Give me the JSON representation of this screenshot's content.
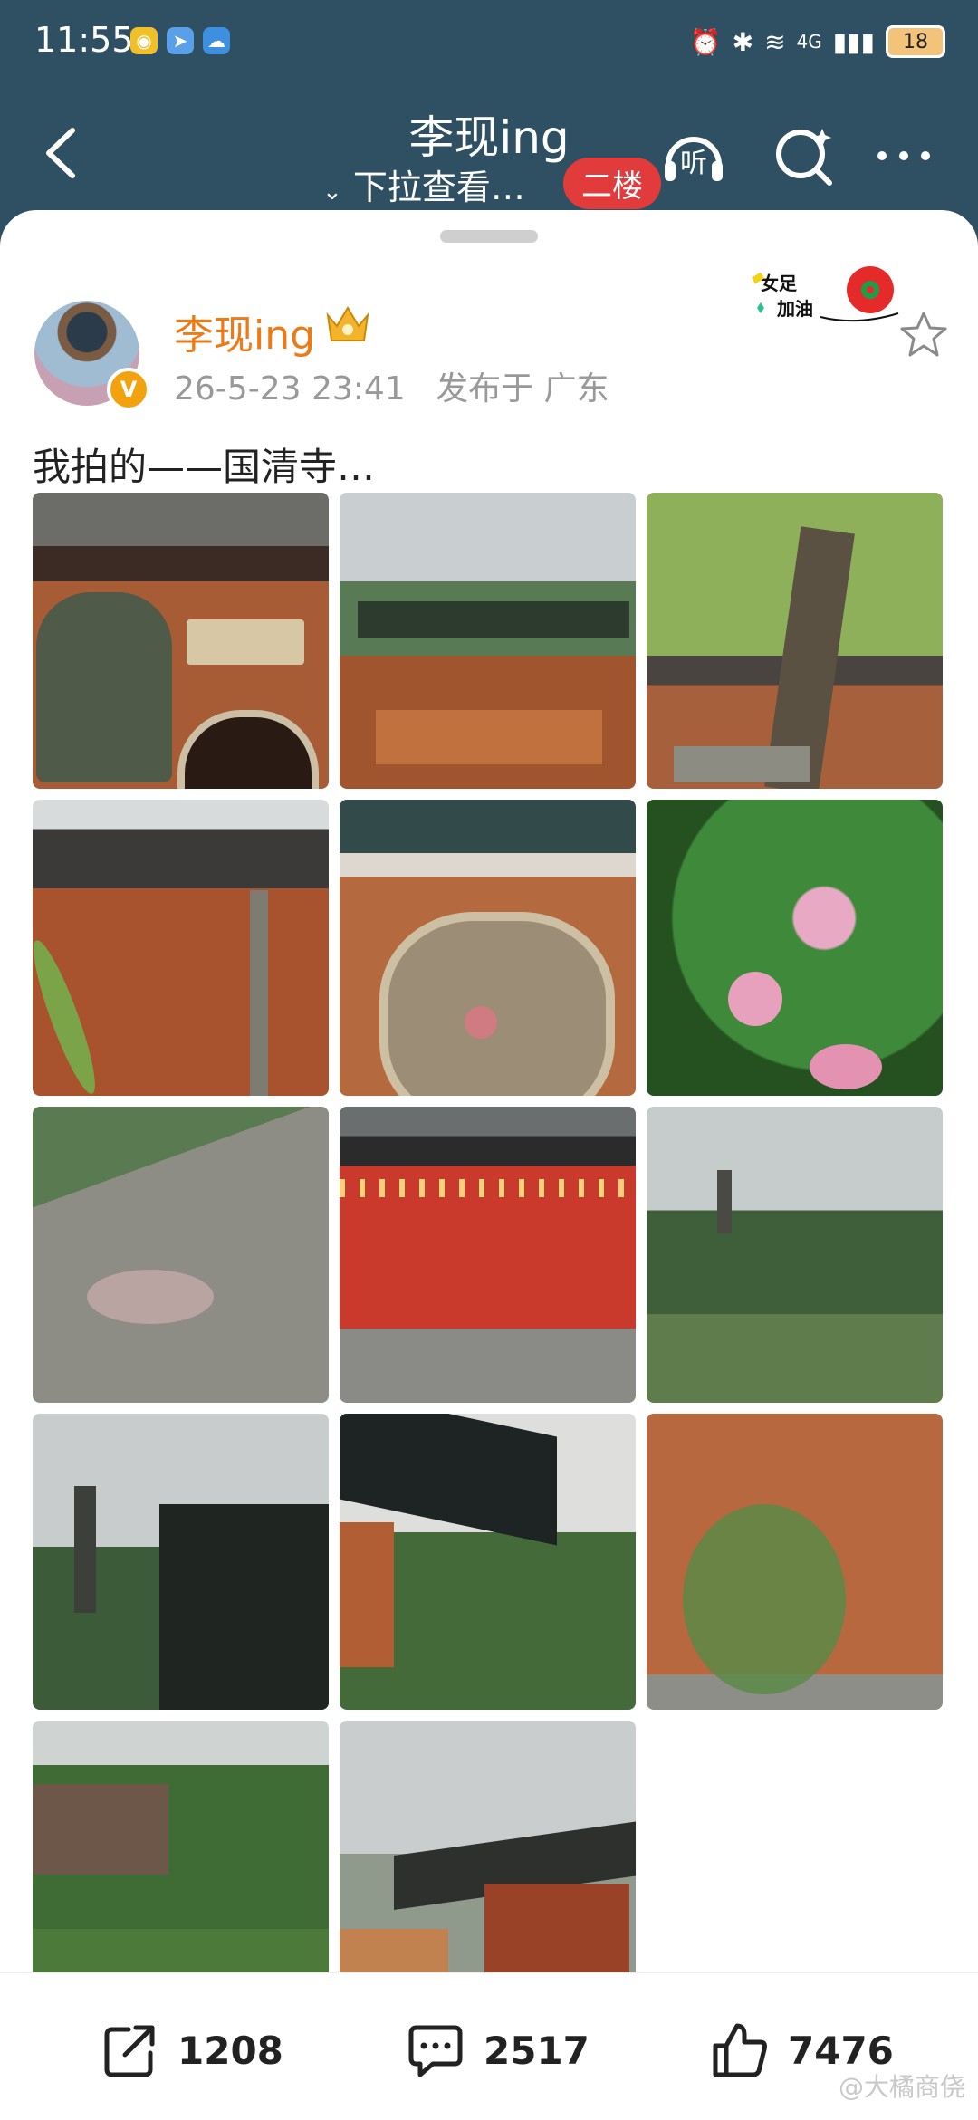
{
  "status_bar": {
    "time": "11:55",
    "network": "4G",
    "battery": "18"
  },
  "header": {
    "title": "李现ing",
    "subtitle": "下拉查看…",
    "floor_badge": "二楼",
    "listen_label": "听"
  },
  "post": {
    "author": "李现ing",
    "verified_badge": "V",
    "time": "26-5-23 23:41",
    "location": "发布于 广东",
    "sticker_line1": "女足",
    "sticker_line2": "加油",
    "text": "我拍的——国清寺…",
    "photos": [
      {
        "name": "photo-lion-gate"
      },
      {
        "name": "photo-misty-gate"
      },
      {
        "name": "photo-tree-wall"
      },
      {
        "name": "photo-courtyard"
      },
      {
        "name": "photo-window"
      },
      {
        "name": "photo-blossom"
      },
      {
        "name": "photo-petals"
      },
      {
        "name": "photo-candles"
      },
      {
        "name": "photo-pagoda-field"
      },
      {
        "name": "photo-pagoda-roof"
      },
      {
        "name": "photo-eaves"
      },
      {
        "name": "photo-red-wall"
      },
      {
        "name": "photo-garden"
      },
      {
        "name": "photo-hall"
      }
    ]
  },
  "actions": {
    "repost_count": "1208",
    "comment_count": "2517",
    "like_count": "7476"
  },
  "watermark": "@大橘商侥",
  "colors": {
    "header_bg": "#2f4f63",
    "username": "#ee7a16",
    "badge": "#e23b3b"
  }
}
